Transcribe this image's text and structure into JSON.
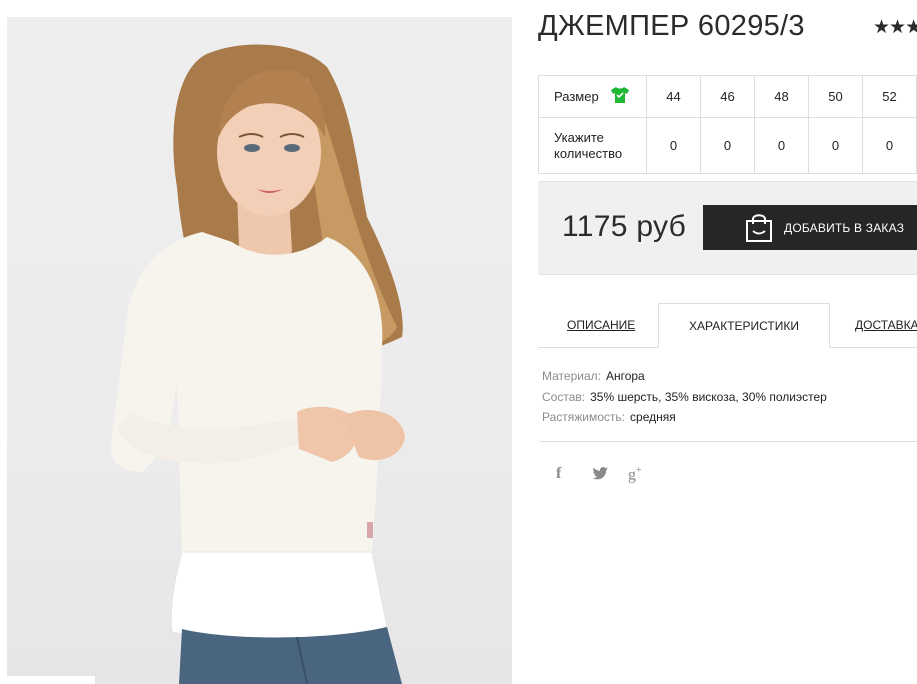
{
  "product": {
    "title": "ДЖЕМПЕР 60295/3",
    "rating_stars": "★★★"
  },
  "size_table": {
    "size_label": "Размер",
    "size_icon": "shirt-icon",
    "qty_label": "Укажите количество",
    "sizes": [
      "44",
      "46",
      "48",
      "50",
      "52"
    ],
    "quantities": [
      "0",
      "0",
      "0",
      "0",
      "0"
    ]
  },
  "purchase": {
    "price": "1175 руб",
    "add_button_label": "ДОБАВИТЬ В ЗАКАЗ",
    "button_icon": "shopping-bag-icon"
  },
  "tabs": {
    "description": "ОПИСАНИЕ",
    "characteristics": "ХАРАКТЕРИСТИКИ",
    "delivery": "ДОСТАВКА",
    "active": "characteristics"
  },
  "specs": [
    {
      "key": "Материал:",
      "value": "Ангора"
    },
    {
      "key": "Состав:",
      "value": "35% шерсть, 35% вискоза, 30% полиэстер"
    },
    {
      "key": "Растяжимость:",
      "value": "средняя"
    }
  ],
  "social": {
    "facebook": "f",
    "twitter": "twitter-bird-icon",
    "googleplus": "g"
  },
  "colors": {
    "accent_icon": "#1fb833",
    "button_bg": "#262626",
    "price_box_bg": "#f0f0f0"
  }
}
